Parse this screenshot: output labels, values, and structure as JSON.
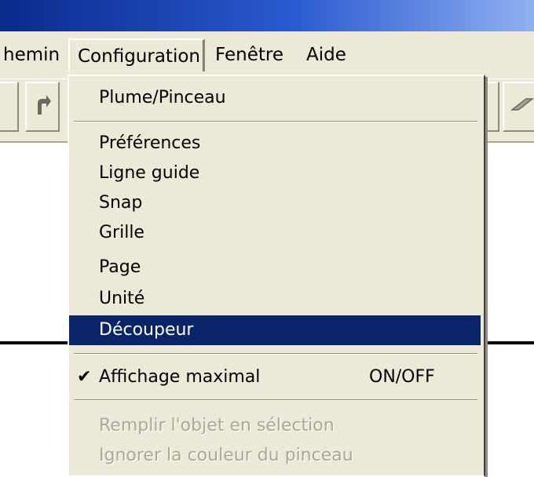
{
  "menubar": {
    "items": [
      {
        "label": "hemin"
      },
      {
        "label": "Configuration"
      },
      {
        "label": "Fenêtre"
      },
      {
        "label": "Aide"
      }
    ]
  },
  "toolbar": {
    "icons": [
      "tool-icon",
      "redo-icon",
      "tool-icon",
      "pen-icon"
    ]
  },
  "menu": {
    "items": [
      {
        "label": "Plume/Pinceau",
        "state": "normal"
      },
      {
        "label": "Préférences",
        "state": "normal"
      },
      {
        "label": "Ligne guide",
        "state": "normal"
      },
      {
        "label": "Snap",
        "state": "normal"
      },
      {
        "label": "Grille",
        "state": "normal"
      },
      {
        "label": "Page",
        "state": "normal"
      },
      {
        "label": "Unité",
        "state": "normal"
      },
      {
        "label": "Découpeur",
        "state": "selected"
      },
      {
        "label": "Affichage maximal",
        "shortcut": "ON/OFF",
        "checked": true,
        "state": "normal"
      },
      {
        "label": "Remplir l'objet en sélection",
        "state": "disabled"
      },
      {
        "label": "Ignorer la couleur du pinceau",
        "state": "disabled"
      }
    ],
    "check_mark": "✔"
  },
  "colors": {
    "menu_bg": "#ece9d8",
    "selection": "#0a246a",
    "disabled_text": "#a9a69a",
    "title_bar": "#0a2a8c"
  }
}
